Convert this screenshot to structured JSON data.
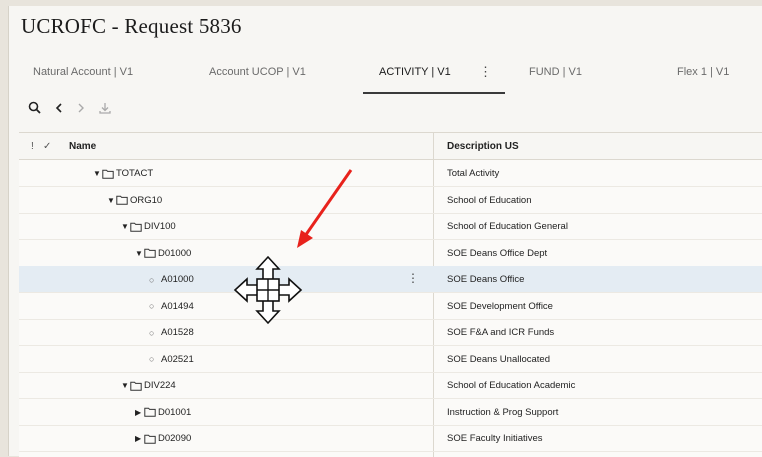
{
  "app": {
    "title": "UCROFC - Request 5836"
  },
  "tabs": [
    {
      "label": "Natural Account | V1",
      "active": false
    },
    {
      "label": "Account UCOP | V1",
      "active": false
    },
    {
      "label": "ACTIVITY | V1",
      "active": true
    },
    {
      "label": "FUND | V1",
      "active": false
    },
    {
      "label": "Flex 1 | V1",
      "active": false
    }
  ],
  "tab_menu_glyph": "⋮",
  "toolbar": {
    "icons": [
      "search-icon",
      "chevron-left-icon",
      "chevron-right-icon",
      "download-icon"
    ]
  },
  "grid": {
    "header": {
      "col1_mark": "!",
      "col2_mark": "✓",
      "name": "Name",
      "description": "Description US"
    },
    "rows": [
      {
        "name": "TOTACT",
        "description": "Total Activity",
        "type": "folder",
        "expanded": true,
        "level": 0,
        "selected": false
      },
      {
        "name": "ORG10",
        "description": "School of Education",
        "type": "folder",
        "expanded": true,
        "level": 1,
        "selected": false
      },
      {
        "name": "DIV100",
        "description": "School of Education General",
        "type": "folder",
        "expanded": true,
        "level": 2,
        "selected": false
      },
      {
        "name": "D01000",
        "description": "SOE Deans Office Dept",
        "type": "folder",
        "expanded": true,
        "level": 3,
        "selected": false
      },
      {
        "name": "A01000",
        "description": "SOE Deans Office",
        "type": "leaf",
        "level": 4,
        "selected": true
      },
      {
        "name": "A01494",
        "description": "SOE Development Office",
        "type": "leaf",
        "level": 4,
        "selected": false
      },
      {
        "name": "A01528",
        "description": "SOE F&A and ICR Funds",
        "type": "leaf",
        "level": 4,
        "selected": false
      },
      {
        "name": "A02521",
        "description": "SOE Deans Unallocated",
        "type": "leaf",
        "level": 4,
        "selected": false
      },
      {
        "name": "DIV224",
        "description": "School of Education Academic",
        "type": "folder",
        "expanded": true,
        "level": 2,
        "selected": false
      },
      {
        "name": "D01001",
        "description": "Instruction & Prog Support",
        "type": "folder",
        "expanded": false,
        "level": 3,
        "selected": false
      },
      {
        "name": "D02090",
        "description": "SOE Faculty Initiatives",
        "type": "folder",
        "expanded": false,
        "level": 3,
        "selected": false
      }
    ],
    "row_menu_glyph": "⋮"
  },
  "glyphs": {
    "caret_down": "▼",
    "caret_right": "▶",
    "leaf_bullet": "○"
  },
  "colors": {
    "annotation_arrow": "#e8221c",
    "selected_row": "#e4ecf3",
    "active_tab_underline": "#3a3a3a"
  }
}
